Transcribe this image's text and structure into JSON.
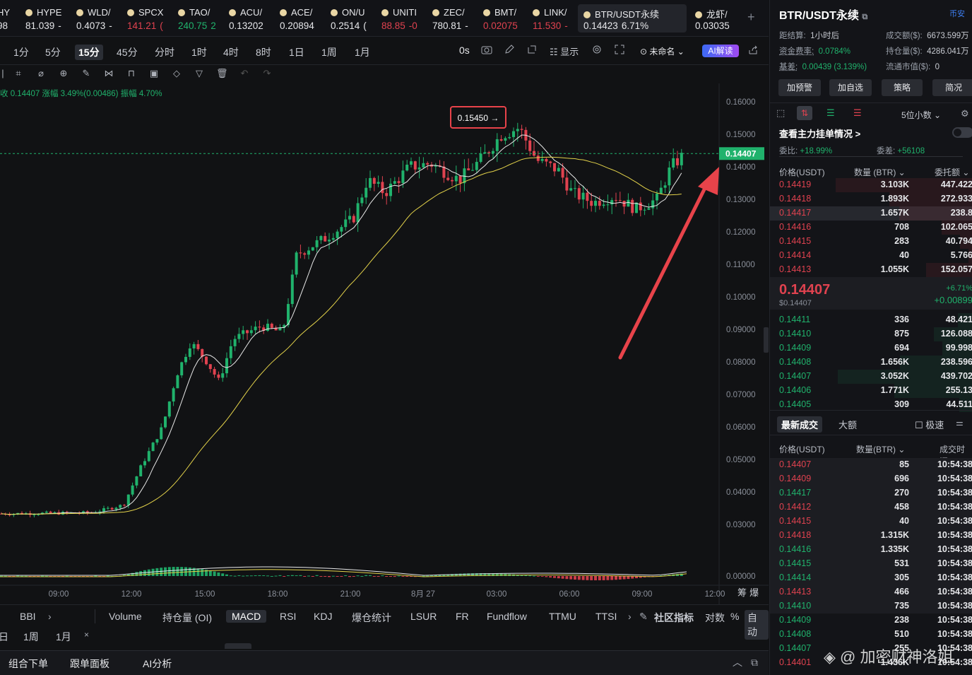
{
  "tickers": [
    {
      "name": "HY",
      "price": "98",
      "change": "",
      "dir": "neutral"
    },
    {
      "name": "HYPE",
      "price": "81.039",
      "change": "-",
      "dir": "neutral"
    },
    {
      "name": "WLD/",
      "price": "0.4073",
      "change": "-",
      "dir": "neutral"
    },
    {
      "name": "SPCX",
      "price": "141.21",
      "change": "(",
      "dir": "red"
    },
    {
      "name": "TAO/",
      "price": "240.75",
      "change": "2",
      "dir": "green"
    },
    {
      "name": "ACU/",
      "price": "0.13202",
      "change": "",
      "dir": "neutral"
    },
    {
      "name": "ACE/",
      "price": "0.20894",
      "change": "",
      "dir": "neutral"
    },
    {
      "name": "ON/U",
      "price": "0.2514",
      "change": "(",
      "dir": "neutral"
    },
    {
      "name": "UNITI",
      "price": "88.85",
      "change": "-0",
      "dir": "red"
    },
    {
      "name": "ZEC/",
      "price": "780.81",
      "change": "-",
      "dir": "neutral"
    },
    {
      "name": "BMT/",
      "price": "0.02075",
      "change": "",
      "dir": "red"
    },
    {
      "name": "LINK/",
      "price": "11.530",
      "change": "-",
      "dir": "red"
    },
    {
      "name": "BTR/USDT永续",
      "price": "0.14423",
      "change": "6.71%",
      "dir": "neutral",
      "active": true
    },
    {
      "name": "龙虾/",
      "price": "0.03035",
      "change": "",
      "dir": "neutral"
    }
  ],
  "timeframes": [
    "1分",
    "5分",
    "15分",
    "45分",
    "分时",
    "1时",
    "4时",
    "8时",
    "1日",
    "1周",
    "1月"
  ],
  "selected_timeframe": "15分",
  "toolbar": {
    "countdown": "0s",
    "display_label": "显示",
    "layout_label": "未命名",
    "ai_label": "AI解读"
  },
  "info_line": {
    "close": "收 0.14407",
    "change": "涨幅 3.49%(0.00486)",
    "amplitude": "振幅 4.70%"
  },
  "chart_data": {
    "type": "candlestick",
    "symbol": "BTR/USDT永续",
    "interval": "15分",
    "y_ticks": [
      "0.16000",
      "0.15000",
      "0.14000",
      "0.13000",
      "0.12000",
      "0.11000",
      "0.10000",
      "0.09000",
      "0.08000",
      "0.07000",
      "0.06000",
      "0.05000",
      "0.04000",
      "0.03000",
      "0.00000"
    ],
    "x_ticks": [
      "09:00",
      "12:00",
      "15:00",
      "18:00",
      "21:00",
      "8月 27",
      "03:00",
      "06:00",
      "09:00",
      "12:00"
    ],
    "current_price_label": "0.14407",
    "high_annotation": "0.15450 →",
    "ylim": [
      0.025,
      0.16
    ],
    "ma_lines": [
      "white (short MA)",
      "yellow (long MA)"
    ],
    "colors": {
      "up": "#20b26c",
      "down": "#e0424f",
      "ma_short": "#e8e8e8",
      "ma_long": "#e3d24a",
      "arrow": "#e8434a"
    },
    "candles_summary": [
      {
        "time": "09:00",
        "close": 0.0335
      },
      {
        "time": "12:00",
        "close": 0.034
      },
      {
        "time": "13:00",
        "close": 0.045
      },
      {
        "time": "15:00",
        "close": 0.078
      },
      {
        "time": "16:00",
        "close": 0.0845
      },
      {
        "time": "18:00",
        "close": 0.09
      },
      {
        "time": "19:00",
        "close": 0.1175
      },
      {
        "time": "21:00",
        "close": 0.1365
      },
      {
        "time": "8月 27",
        "close": 0.1395
      },
      {
        "time": "03:00",
        "close": 0.1475
      },
      {
        "time": "04:00",
        "close": 0.1545
      },
      {
        "time": "06:00",
        "close": 0.1305
      },
      {
        "time": "08:00",
        "close": 0.1285
      },
      {
        "time": "10:00",
        "close": 0.1441
      }
    ]
  },
  "indicators": [
    "BBI",
    "Volume",
    "持仓量 (OI)",
    "MACD",
    "RSI",
    "KDJ",
    "爆仓统计",
    "LSUR",
    "FR",
    "Fundflow",
    "TTMU",
    "TTSI",
    "社区指标",
    "对数",
    "%",
    "自动"
  ],
  "selected_indicator": "MACD",
  "periods": [
    "日",
    "1周",
    "1月"
  ],
  "bottom": {
    "order": "组合下单",
    "copy": "跟单面板",
    "ai": "AI分析"
  },
  "right": {
    "title": "BTR/USDT永续",
    "exchange": "币安",
    "settle": {
      "k": "距结算:",
      "v": "1小时后"
    },
    "turnover": {
      "k": "成交额($):",
      "v": "6673.599万"
    },
    "funding": {
      "k": "资金费率:",
      "v": "0.0784%"
    },
    "oi": {
      "k": "持仓量($):",
      "v": "4286.041万"
    },
    "basis": {
      "k": "基差:",
      "v": "0.00439 (3.139%)"
    },
    "mcap": {
      "k": "流通市值($):",
      "v": "0"
    },
    "buttons": [
      "加预警",
      "加自选",
      "策略",
      "简况"
    ],
    "decimals": "5位小数",
    "main_orders": "查看主力挂单情况 >",
    "wei_bi": {
      "k": "委比:",
      "v": "+18.99%"
    },
    "wei_cha": {
      "k": "委差:",
      "v": "+56108"
    },
    "ob_headers": [
      "价格(USDT)",
      "数量 (BTR)",
      "委托额"
    ],
    "asks": [
      {
        "p": "0.14419",
        "q": "3.103K",
        "t": "447.422"
      },
      {
        "p": "0.14418",
        "q": "1.893K",
        "t": "272.933"
      },
      {
        "p": "0.14417",
        "q": "1.657K",
        "t": "238.8"
      },
      {
        "p": "0.14416",
        "q": "708",
        "t": "102.065"
      },
      {
        "p": "0.14415",
        "q": "283",
        "t": "40.794"
      },
      {
        "p": "0.14414",
        "q": "40",
        "t": "5.766"
      },
      {
        "p": "0.14413",
        "q": "1.055K",
        "t": "152.057"
      }
    ],
    "last_price": "0.14407",
    "last_usd": "$0.14407",
    "last_pct": "+6.71%",
    "last_abs": "+0.00899",
    "bids": [
      {
        "p": "0.14411",
        "q": "336",
        "t": "48.421"
      },
      {
        "p": "0.14410",
        "q": "875",
        "t": "126.088"
      },
      {
        "p": "0.14409",
        "q": "694",
        "t": "99.998"
      },
      {
        "p": "0.14408",
        "q": "1.656K",
        "t": "238.596"
      },
      {
        "p": "0.14407",
        "q": "3.052K",
        "t": "439.702"
      },
      {
        "p": "0.14406",
        "q": "1.771K",
        "t": "255.13"
      },
      {
        "p": "0.14405",
        "q": "309",
        "t": "44.511"
      }
    ],
    "trade_tabs": [
      "最新成交",
      "大额"
    ],
    "fast_label": "极速",
    "tr_headers": [
      "价格(USDT)",
      "数量(BTR)",
      "成交时间"
    ],
    "trades": [
      {
        "p": "0.14407",
        "q": "85",
        "t": "10:54:38",
        "d": "red"
      },
      {
        "p": "0.14409",
        "q": "696",
        "t": "10:54:38",
        "d": "red"
      },
      {
        "p": "0.14417",
        "q": "270",
        "t": "10:54:38",
        "d": "green"
      },
      {
        "p": "0.14412",
        "q": "458",
        "t": "10:54:38",
        "d": "red"
      },
      {
        "p": "0.14415",
        "q": "40",
        "t": "10:54:38",
        "d": "red"
      },
      {
        "p": "0.14418",
        "q": "1.315K",
        "t": "10:54:38",
        "d": "red"
      },
      {
        "p": "0.14416",
        "q": "1.335K",
        "t": "10:54:38",
        "d": "green"
      },
      {
        "p": "0.14415",
        "q": "531",
        "t": "10:54:38",
        "d": "green"
      },
      {
        "p": "0.14414",
        "q": "305",
        "t": "10:54:38",
        "d": "green"
      },
      {
        "p": "0.14413",
        "q": "466",
        "t": "10:54:38",
        "d": "red"
      },
      {
        "p": "0.14410",
        "q": "735",
        "t": "10:54:38",
        "d": "green"
      },
      {
        "p": "0.14409",
        "q": "238",
        "t": "10:54:38",
        "d": "green"
      },
      {
        "p": "0.14408",
        "q": "510",
        "t": "10:54:38",
        "d": "green"
      },
      {
        "p": "0.14407",
        "q": "255",
        "t": "10:54:38",
        "d": "green"
      },
      {
        "p": "0.14401",
        "q": "1.436K",
        "t": "10:54:38",
        "d": "red"
      }
    ],
    "watermark": "@ 加密财神洛姐"
  }
}
